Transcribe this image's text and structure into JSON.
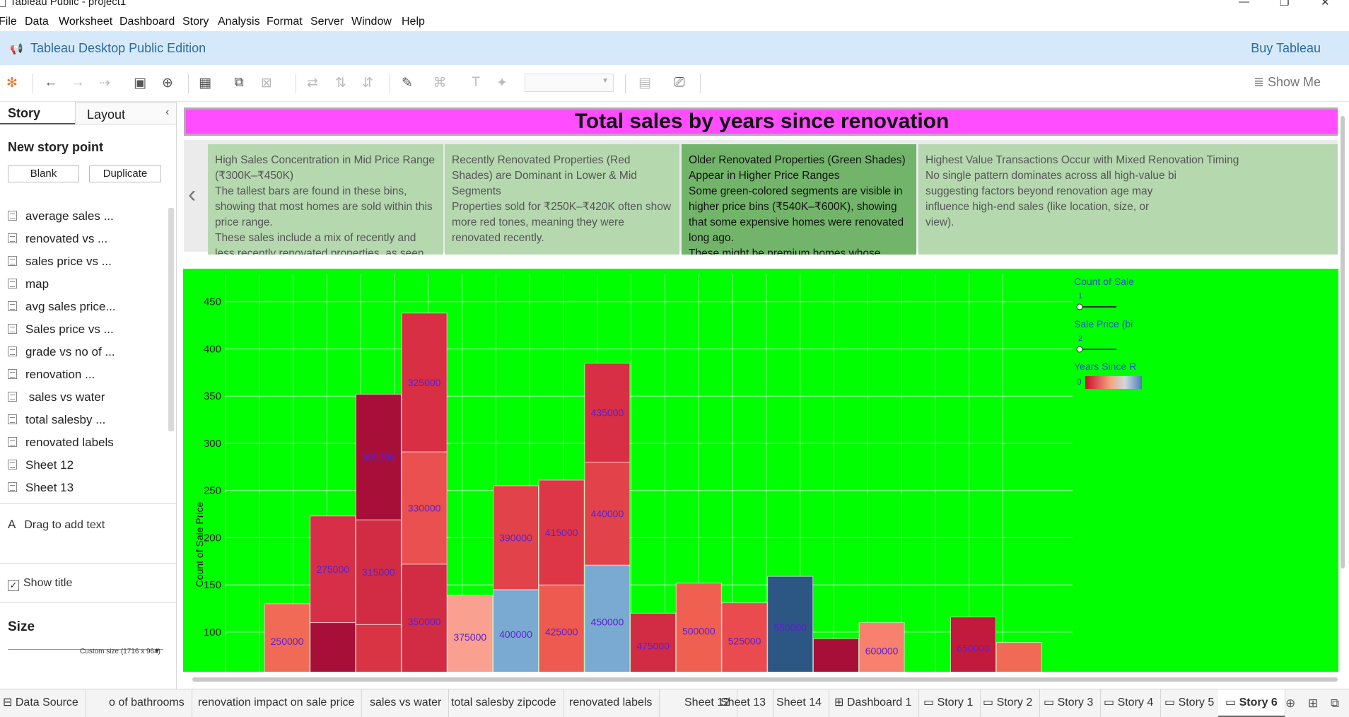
{
  "window": {
    "title": "Tableau Public - project1"
  },
  "menu": [
    "File",
    "Data",
    "Worksheet",
    "Dashboard",
    "Story",
    "Analysis",
    "Format",
    "Server",
    "Window",
    "Help"
  ],
  "banner": {
    "title": "Tableau Desktop Public Edition",
    "buy": "Buy Tableau"
  },
  "toolbar": {
    "show_me": "Show Me"
  },
  "left_panel": {
    "tab_story": "Story",
    "tab_layout": "Layout",
    "new_story_point": "New story point",
    "blank": "Blank",
    "duplicate": "Duplicate",
    "sheets": [
      "average sales ...",
      "renovated vs ...",
      "sales price vs ...",
      "map",
      "avg sales price...",
      "Sales price vs ...",
      "grade vs no of ...",
      "renovation ...",
      " sales vs water",
      "total salesby ...",
      "renovated labels",
      "Sheet 12",
      "Sheet 13"
    ],
    "drag_to_add_text": "Drag to add text",
    "show_title": "Show title",
    "size_label": "Size",
    "size_value": "Custom size (1716 x 964)"
  },
  "story": {
    "title": "Total sales by years since renovation",
    "points": [
      {
        "heading": "High Sales Concentration in Mid Price Range (₹300K–₹450K)",
        "lines": [
          "The tallest bars are found in these bins, showing that most homes are sold within this price range.",
          "These sales include a mix of recently and less recently renovated properties, as seen from the color"
        ]
      },
      {
        "heading": "Recently Renovated Properties (Red Shades) are Dominant in Lower & Mid Segments",
        "lines": [
          "Properties sold for ₹250K–₹420K often show more red tones, meaning they were renovated recently."
        ]
      },
      {
        "heading": "Older Renovated Properties (Green Shades) Appear in Higher Price Ranges",
        "lines": [
          "Some green-colored segments are visible in higher price bins (₹540K–₹600K), showing that some expensive homes were renovated long ago.",
          "These might be premium homes whose renovation"
        ]
      },
      {
        "heading": "Highest Value Transactions Occur with Mixed Renovation Timing",
        "lines": [
          "No single pattern dominates across all high-value bi",
          "suggesting factors beyond renovation age may influence high-end sales (like location, size, or view)."
        ]
      }
    ]
  },
  "chart_data": {
    "type": "bar",
    "stacked": true,
    "ylabel": "Count of Sale Price",
    "yticks": [
      100,
      150,
      200,
      250,
      300,
      350,
      400,
      450
    ],
    "ylim_visible": [
      58,
      470
    ],
    "background": "#00ff00",
    "bars": [
      {
        "segments": [
          {
            "label": "250000",
            "top": 130,
            "color": "#f06a55"
          }
        ]
      },
      {
        "segments": [
          {
            "label": "",
            "top": 110,
            "color": "#a80f38"
          },
          {
            "label": "275000",
            "top": 223,
            "color": "#d62f47"
          }
        ]
      },
      {
        "segments": [
          {
            "label": "",
            "top": 108,
            "color": "#d93444"
          },
          {
            "label": "315000",
            "top": 219,
            "color": "#d22c44"
          },
          {
            "label": "300000",
            "top": 352,
            "color": "#a80f38"
          }
        ]
      },
      {
        "segments": [
          {
            "label": "350000",
            "top": 172,
            "color": "#d22c44"
          },
          {
            "label": "330000",
            "top": 291,
            "color": "#ea5050"
          },
          {
            "label": "325000",
            "top": 438,
            "color": "#d82f45"
          }
        ]
      },
      {
        "segments": [
          {
            "label": "375000",
            "top": 139,
            "color": "#f9a090"
          }
        ]
      },
      {
        "segments": [
          {
            "label": "400000",
            "top": 145,
            "color": "#7aaad2"
          },
          {
            "label": "390000",
            "top": 255,
            "color": "#e2434b"
          }
        ]
      },
      {
        "segments": [
          {
            "label": "425000",
            "top": 150,
            "color": "#ef5a50"
          },
          {
            "label": "415000",
            "top": 261,
            "color": "#de3646"
          }
        ]
      },
      {
        "segments": [
          {
            "label": "450000",
            "top": 171,
            "color": "#7aaad2"
          },
          {
            "label": "440000",
            "top": 280,
            "color": "#e2434b"
          },
          {
            "label": "435000",
            "top": 385,
            "color": "#d82f45"
          }
        ]
      },
      {
        "segments": [
          {
            "label": "475000",
            "top": 120,
            "color": "#d22c44"
          }
        ]
      },
      {
        "segments": [
          {
            "label": "500000",
            "top": 152,
            "color": "#f06050"
          }
        ]
      },
      {
        "segments": [
          {
            "label": "525000",
            "top": 131,
            "color": "#ea4b4e"
          }
        ]
      },
      {
        "segments": [
          {
            "label": "550000",
            "top": 159,
            "color": "#2c5784"
          }
        ]
      },
      {
        "segments": [
          {
            "label": "",
            "top": 93,
            "color": "#a80f38"
          }
        ]
      },
      {
        "segments": [
          {
            "label": "600000",
            "top": 110,
            "color": "#f8806e"
          }
        ]
      },
      {
        "segments": []
      },
      {
        "segments": [
          {
            "label": "650000",
            "top": 116,
            "color": "#c21a3c"
          }
        ]
      },
      {
        "segments": [
          {
            "label": "",
            "top": 89,
            "color": "#f06a55"
          }
        ]
      }
    ],
    "legend": {
      "count_title": "Count of Sale",
      "count_value": "1",
      "bins_title": "Sale Price (bi",
      "bins_value": "2",
      "years_title": "Years Since R",
      "years_value": "0"
    }
  },
  "bottom_tabs": [
    {
      "label": "Data Source",
      "icon": "database-icon"
    },
    {
      "label": "o of bathrooms"
    },
    {
      "label": "renovation impact on sale price"
    },
    {
      "label": "sales vs water"
    },
    {
      "label": "total salesby zipcode"
    },
    {
      "label": "renovated labels"
    },
    {
      "label": "Sheet 12"
    },
    {
      "label": "Sheet 13"
    },
    {
      "label": "Sheet 14"
    },
    {
      "label": "Dashboard 1",
      "icon": "dashboard-icon"
    },
    {
      "label": "Story 1",
      "icon": "story-icon"
    },
    {
      "label": "Story 2",
      "icon": "story-icon"
    },
    {
      "label": "Story 3",
      "icon": "story-icon"
    },
    {
      "label": "Story 4",
      "icon": "story-icon"
    },
    {
      "label": "Story 5",
      "icon": "story-icon"
    },
    {
      "label": "Story 6",
      "icon": "story-icon",
      "active": true
    }
  ]
}
